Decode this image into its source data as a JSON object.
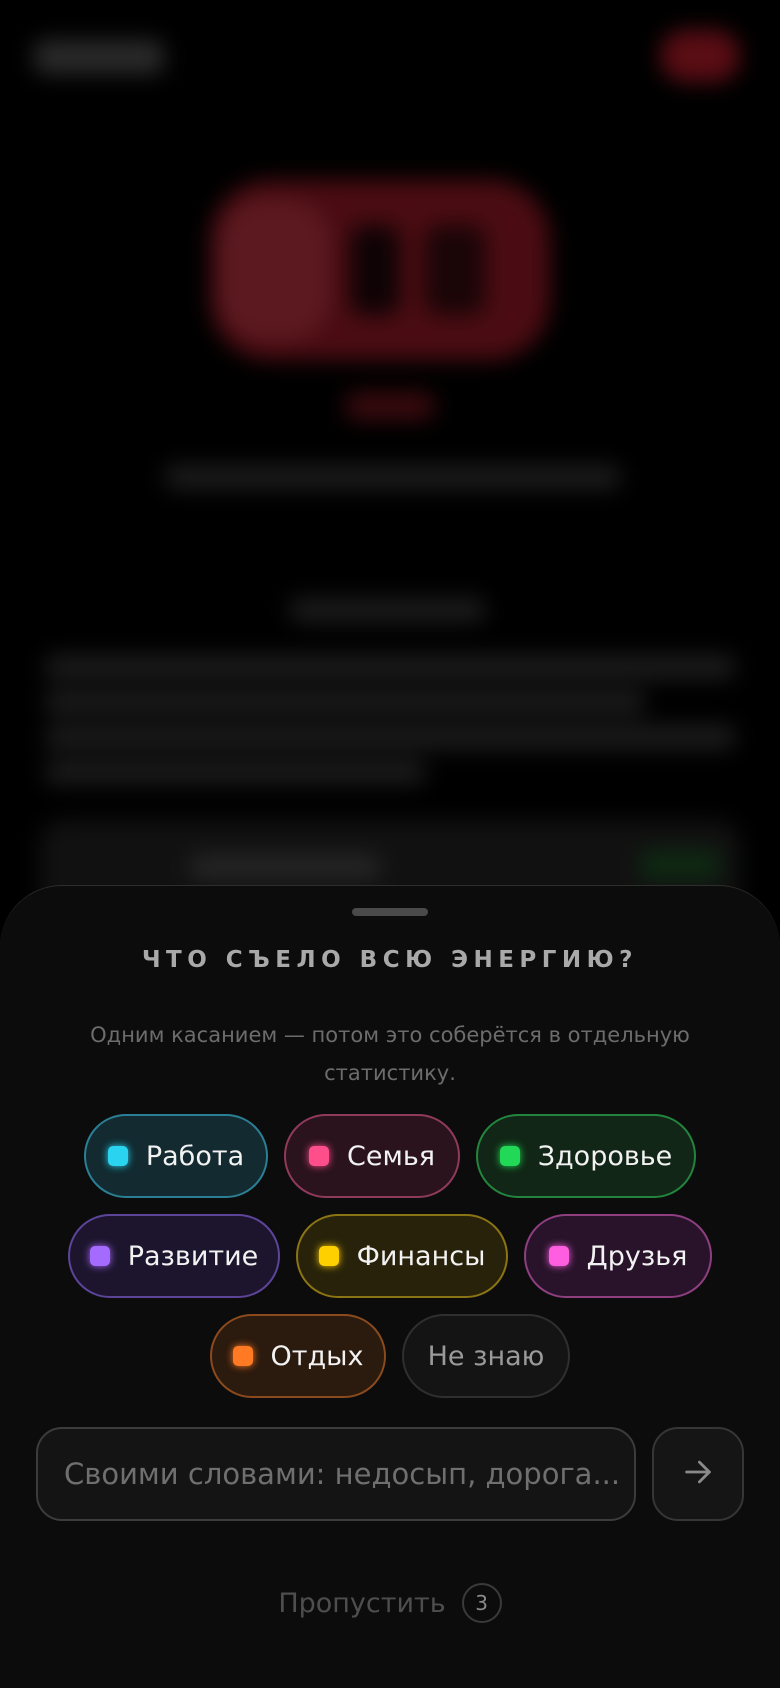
{
  "sheet": {
    "title": "ЧТО СЪЕЛО ВСЮ ЭНЕРГИЮ?",
    "subtitle": "Одним касанием — потом это соберётся в отдельную статистику."
  },
  "categories": [
    {
      "label": "Работа",
      "dot_color": "#2ad4f0",
      "border_color": "#2b7f94",
      "bg_color": "#122a30"
    },
    {
      "label": "Семья",
      "dot_color": "#ff4f8b",
      "border_color": "#8f3a5a",
      "bg_color": "#2a131d"
    },
    {
      "label": "Здоровье",
      "dot_color": "#22d957",
      "border_color": "#23843d",
      "bg_color": "#112616"
    },
    {
      "label": "Развитие",
      "dot_color": "#a56bff",
      "border_color": "#5c4499",
      "bg_color": "#1d152e"
    },
    {
      "label": "Финансы",
      "dot_color": "#ffd000",
      "border_color": "#8a7414",
      "bg_color": "#28220a"
    },
    {
      "label": "Друзья",
      "dot_color": "#ff5ee0",
      "border_color": "#8d3f80",
      "bg_color": "#28132a"
    },
    {
      "label": "Отдых",
      "dot_color": "#ff7a22",
      "border_color": "#8a4a1e",
      "bg_color": "#2b1a0e"
    }
  ],
  "unknown_option": {
    "label": "Не знаю"
  },
  "input": {
    "placeholder": "Своими словами: недосып, дорога..."
  },
  "send": {
    "icon": "arrow-right-icon"
  },
  "skip": {
    "label": "Пропустить",
    "count": "3"
  }
}
